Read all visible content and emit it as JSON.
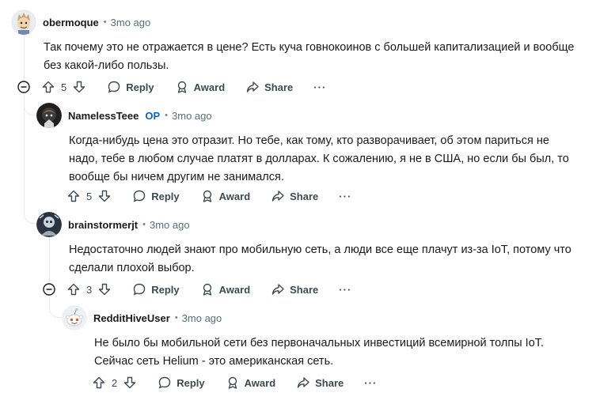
{
  "comments": [
    {
      "author": "obermoque",
      "dot": "•",
      "time": "3mo ago",
      "text": "Так почему это не отражается в цене? Есть куча говнокоинов с большей капитализацией и вообще без какой-либо пользы.",
      "score": "5",
      "reply": "Reply",
      "award": "Award",
      "share": "Share",
      "more": "···"
    },
    {
      "author": "NamelessTeee",
      "op_badge": "OP",
      "dot": "•",
      "time": "3mo ago",
      "text": "Когда-нибудь цена это отразит. Но тебе, как тому, кто разворачивает, об этом париться не надо, тебе в любом случае платят в долларах. К сожалению, я не в США, но если бы был, то вообще бы ничем другим не занимался.",
      "score": "5",
      "reply": "Reply",
      "award": "Award",
      "share": "Share",
      "more": "···"
    },
    {
      "author": "brainstormerjt",
      "dot": "•",
      "time": "3mo ago",
      "text": "Недостаточно людей знают про мобильную сеть, а люди все еще плачут из-за IoT, потому что сделали плохой выбор.",
      "score": "3",
      "reply": "Reply",
      "award": "Award",
      "share": "Share",
      "more": "···"
    },
    {
      "author": "RedditHiveUser",
      "dot": "•",
      "time": "3mo ago",
      "text": "Не было бы мобильной сети без первоначальных инвестиций всемирной толпы IoT. Сейчас сеть Helium - это американская сеть.",
      "score": "2",
      "reply": "Reply",
      "award": "Award",
      "share": "Share",
      "more": "···"
    }
  ],
  "colors": {
    "op": "#0a66c2",
    "meta": "#576f76",
    "thread": "#e5ebee"
  },
  "icons": [
    "upvote-icon",
    "downvote-icon",
    "reply-bubble-icon",
    "award-icon",
    "share-arrow-icon",
    "collapse-minus-icon"
  ]
}
